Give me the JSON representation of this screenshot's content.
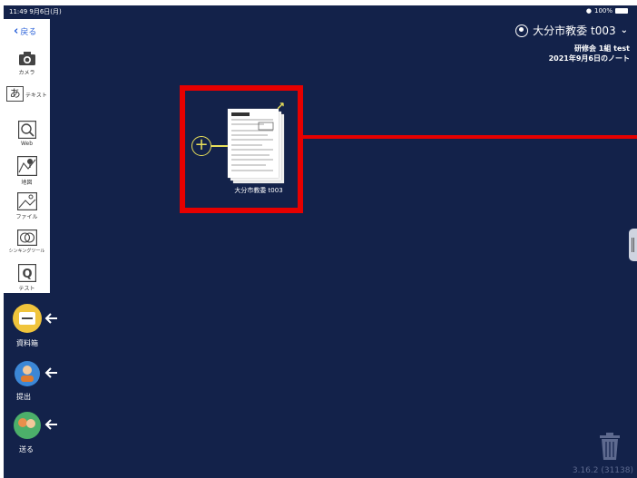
{
  "status_bar": {
    "time_date": "11:49  9月6日(月)",
    "battery": "100%"
  },
  "header": {
    "user_name": "大分市教委 t003",
    "class_name": "研修会 1組 test",
    "note_title": "2021年9月6日のノート"
  },
  "toolbar": {
    "back_label": "戻る",
    "tools": [
      {
        "label": "カメラ",
        "icon": "camera-icon"
      },
      {
        "label": "テキスト",
        "icon": "text-icon"
      },
      {
        "label": "Web",
        "icon": "web-search-icon"
      },
      {
        "label": "地図",
        "icon": "map-icon"
      },
      {
        "label": "ファイル",
        "icon": "file-icon"
      },
      {
        "label": "シンキングツール",
        "icon": "thinking-tool-icon"
      },
      {
        "label": "テスト",
        "icon": "test-icon"
      }
    ]
  },
  "side_actions": [
    {
      "label": "資料箱",
      "icon": "material-box-icon"
    },
    {
      "label": "提出",
      "icon": "submit-icon"
    },
    {
      "label": "送る",
      "icon": "send-icon"
    }
  ],
  "canvas": {
    "card_label": "大分市教委 t003"
  },
  "footer": {
    "version": "3.16.2 (31138)"
  },
  "colors": {
    "background": "#13224a",
    "highlight": "#e60000",
    "accent": "#e9e05a",
    "link": "#2b62d9"
  }
}
